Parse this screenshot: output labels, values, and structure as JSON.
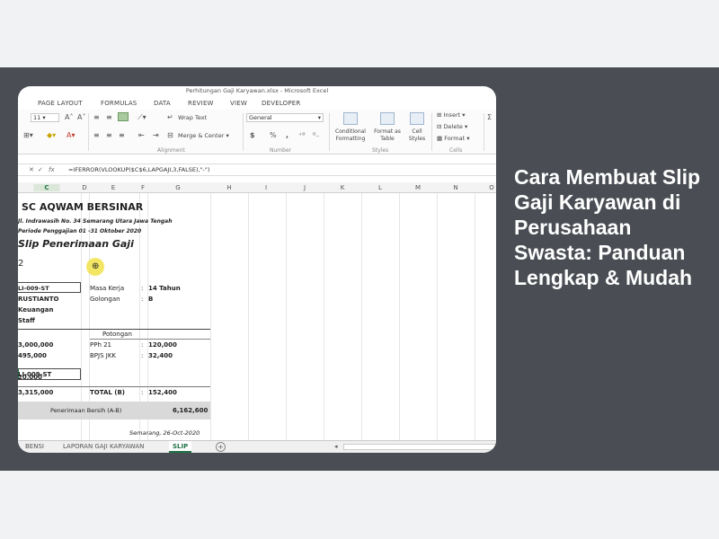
{
  "headline": "Cara Membuat Slip Gaji Karyawan di Perusahaan Swasta: Panduan Lengkap & Mudah",
  "colors": {
    "background": "#f1f2f4",
    "band": "#4a4e54",
    "headline_text": "#ffffff",
    "excel_green": "#217346"
  },
  "excel": {
    "window_title": "Perhitungan Gaji Karyawan.xlsx - Microsoft Excel",
    "ribbon_tabs": [
      "PAGE LAYOUT",
      "FORMULAS",
      "DATA",
      "REVIEW",
      "VIEW",
      "DEVELOPER"
    ],
    "ribbon": {
      "font_size": "11",
      "wrap_text": "Wrap Text",
      "merge_center": "Merge & Center",
      "number_format": "General",
      "currency": "$",
      "percent": "%",
      "comma": ",",
      "conditional_formatting": "Conditional Formatting",
      "format_as_table": "Format as Table",
      "cell_styles": "Cell Styles",
      "insert": "Insert",
      "delete": "Delete",
      "format": "Format",
      "group_alignment": "Alignment",
      "group_number": "Number",
      "group_styles": "Styles",
      "group_cells": "Cells"
    },
    "formula_bar": {
      "fx": "fx",
      "formula": "=IFERROR(VLOOKUP($C$6,LAPGAJI,3,FALSE),\"-\")"
    },
    "columns": [
      "C",
      "D",
      "E",
      "F",
      "G",
      "H",
      "I",
      "J",
      "K",
      "L",
      "M",
      "N",
      "O"
    ],
    "sheet": {
      "company": "SC AQWAM BERSINAR",
      "address": "Jl. Indrawasih No. 34 Semarang Utara Jawa Tengah",
      "period": "Periode Penggajian 01 -31 Oktober 2020",
      "slip_title": "Slip Penerimaan Gaji",
      "row_number": "2",
      "id_value": "LI-009-ST",
      "name_value": "RUSTIANTO",
      "dept_value": "Keuangan",
      "status_value": "Staff",
      "masa_kerja_label": "Masa Kerja",
      "masa_kerja_value": "14 Tahun",
      "golongan_label": "Golongan",
      "golongan_value": "B",
      "colon": ":",
      "potongan_header": "Potongan",
      "pph_label": "PPh 21",
      "pph_value": "120,000",
      "bpjs_label": "BPJS JKK",
      "bpjs_value": "32,400",
      "left_amount_1": "3,000,000",
      "left_amount_2": "495,000",
      "left_amount_3": "20,000",
      "left_total": "3,315,000",
      "total_b_label": "TOTAL (B)",
      "total_b_value": "152,400",
      "net_label": "Penerimaan Bersih (A-B)",
      "net_value": "6,162,600",
      "sign_place_date": "Semarang,  26-Oct-2020"
    },
    "sheet_tabs": [
      "BENSI",
      "LAPORAN GAJI KARYAWAN",
      "SLIP"
    ],
    "active_sheet": "SLIP",
    "add_sheet": "+"
  }
}
